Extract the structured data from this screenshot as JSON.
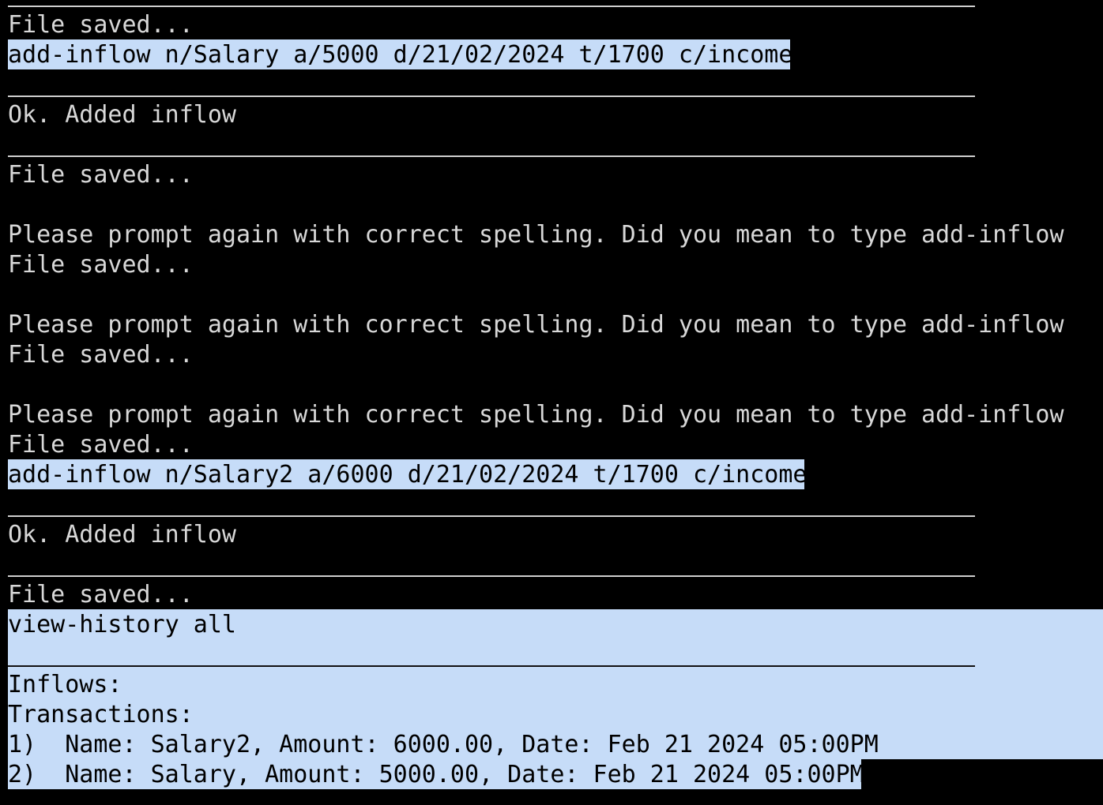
{
  "colors": {
    "background": "#000000",
    "text": "#d8d8d8",
    "selection": "#c6dcf8",
    "selected_text": "#000000"
  },
  "lines": {
    "file_saved_1": "File saved...",
    "cmd_add_inflow_1": "add-inflow n/Salary a/5000 d/21/02/2024 t/1700 c/income",
    "ok_added_1": "Ok. Added inflow",
    "file_saved_2": "File saved...",
    "spelling_1": "Please prompt again with correct spelling. Did you mean to type add-inflow",
    "file_saved_3": "File saved...",
    "spelling_2": "Please prompt again with correct spelling. Did you mean to type add-inflow",
    "file_saved_4": "File saved...",
    "spelling_3": "Please prompt again with correct spelling. Did you mean to type add-inflow",
    "file_saved_5": "File saved...",
    "cmd_add_inflow_2": "add-inflow n/Salary2 a/6000 d/21/02/2024 t/1700 c/income",
    "ok_added_2": "Ok. Added inflow",
    "file_saved_6": "File saved...",
    "cmd_view_history": "view-history all",
    "inflows_header": "Inflows:",
    "transactions_header": "Transactions:",
    "transaction_1": "1)  Name: Salary2, Amount: 6000.00, Date: Feb 21 2024 05:00PM",
    "transaction_2": "2)  Name: Salary, Amount: 5000.00, Date: Feb 21 2024 05:00PM"
  }
}
